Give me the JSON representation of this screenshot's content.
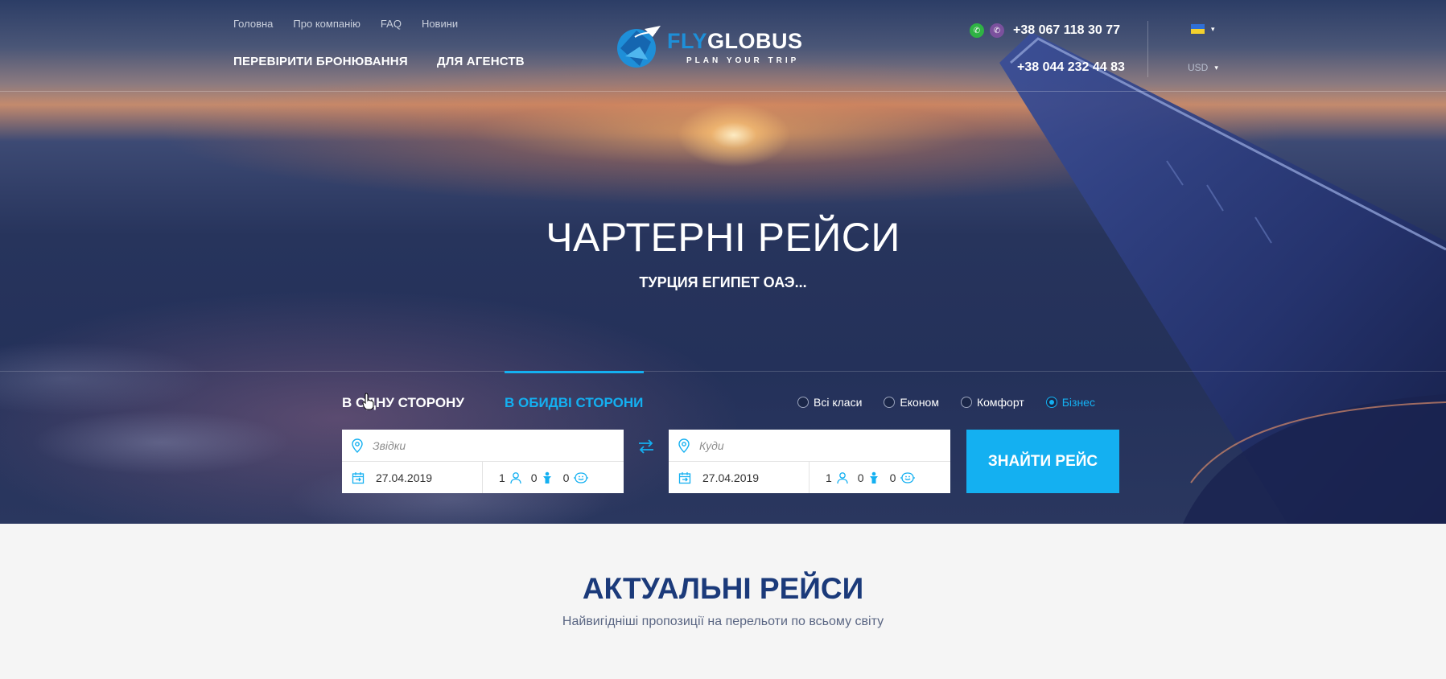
{
  "nav": {
    "small": [
      "Головна",
      "Про компанію",
      "FAQ",
      "Новини"
    ],
    "big": [
      "ПЕРЕВІРИТИ БРОНЮВАННЯ",
      "ДЛЯ АГЕНСТВ"
    ]
  },
  "logo": {
    "fly": "FLY",
    "globus": "GLOBUS",
    "tagline": "PLAN YOUR TRIP"
  },
  "phones": {
    "primary": "+38 067 118 30 77",
    "secondary": "+38 044 232 44 83"
  },
  "lang": {
    "caret": "▾"
  },
  "currency": {
    "value": "USD",
    "caret": "▾"
  },
  "hero": {
    "title": "ЧАРТЕРНІ РЕЙСИ",
    "subtitle": "ТУРЦИЯ ЕГИПЕТ ОАЭ..."
  },
  "tabs": {
    "one_way": "В ОДНУ СТОРОНУ",
    "round_trip": "В ОБИДВІ СТОРОНИ"
  },
  "classes": [
    "Всі класи",
    "Економ",
    "Комфорт",
    "Бізнес"
  ],
  "selected_class": "Бізнес",
  "from": {
    "placeholder": "Звідки",
    "date": "27.04.2019",
    "adults": "1",
    "children": "0",
    "infants": "0"
  },
  "to": {
    "placeholder": "Куди",
    "date": "27.04.2019",
    "adults": "1",
    "children": "0",
    "infants": "0"
  },
  "search_button": "ЗНАЙТИ РЕЙС",
  "section": {
    "title": "АКТУАЛЬНІ РЕЙСИ",
    "subtitle": "Найвигідніші пропозиції на перельоти по всьому світу"
  },
  "colors": {
    "accent": "#14b0f1",
    "heading": "#1b3a7a",
    "brand_blue": "#1e8fd8"
  }
}
